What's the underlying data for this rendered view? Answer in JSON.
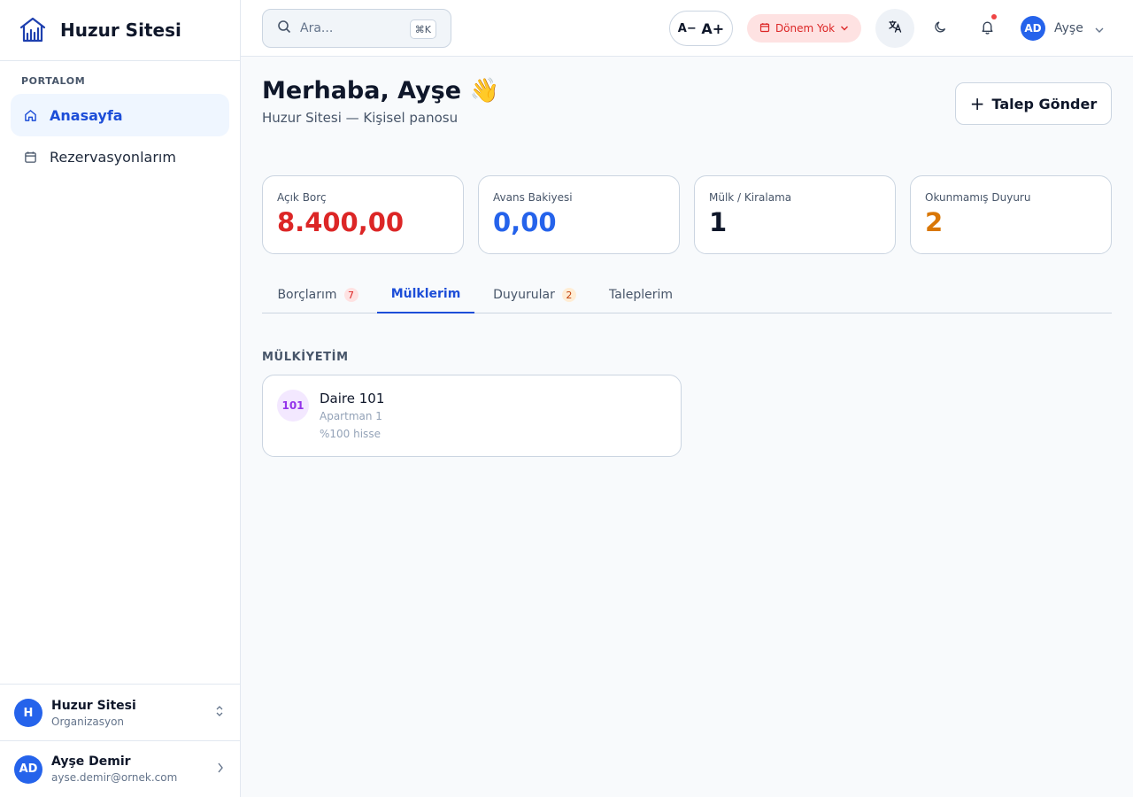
{
  "sidebar": {
    "brand_name": "Huzur Sitesi",
    "section_label": "PORTALOM",
    "items": [
      {
        "label": "Anasayfa",
        "icon": "home-icon",
        "active": true
      },
      {
        "label": "Rezervasyonlarım",
        "icon": "calendar-icon",
        "active": false
      }
    ],
    "org": {
      "initial": "H",
      "name": "Huzur Sitesi",
      "type": "Organizasyon"
    },
    "user": {
      "initials": "AD",
      "name": "Ayşe Demir",
      "email": "ayse.demir@ornek.com"
    }
  },
  "header": {
    "search_placeholder": "Ara...",
    "search_shortcut": "⌘K",
    "font_decrease": "A−",
    "font_increase": "A+",
    "period_label": "Dönem Yok",
    "user_initials": "AD",
    "user_name": "Ayşe",
    "has_notification": true
  },
  "main": {
    "greeting": "Merhaba, Ayşe 👋",
    "subtitle": "Huzur Sitesi — Kişisel panosu",
    "cta_label": "Talep Gönder",
    "stats": [
      {
        "label": "Açık Borç",
        "value": "8.400,00",
        "color": "#dc2626"
      },
      {
        "label": "Avans Bakiyesi",
        "value": "0,00",
        "color": "#2563eb"
      },
      {
        "label": "Mülk / Kiralama",
        "value": "1",
        "color": "#0f172a"
      },
      {
        "label": "Okunmamış Duyuru",
        "value": "2",
        "color": "#d97706"
      }
    ],
    "tabs": [
      {
        "label": "Borçlarım",
        "badge": "7",
        "active": false
      },
      {
        "label": "Mülklerim",
        "badge": "",
        "active": true
      },
      {
        "label": "Duyurular",
        "badge": "2",
        "active": false
      },
      {
        "label": "Taleplerim",
        "badge": "",
        "active": false
      }
    ],
    "section_heading": "MÜLKİYETİM",
    "properties": [
      {
        "unit": "101",
        "title": "Daire 101",
        "building": "Apartman 1",
        "share": "%100 hisse"
      }
    ]
  },
  "colors": {
    "accent": "#1d4ed8",
    "avatar": "#2563eb",
    "danger": "#dc2626",
    "warning": "#d97706"
  }
}
